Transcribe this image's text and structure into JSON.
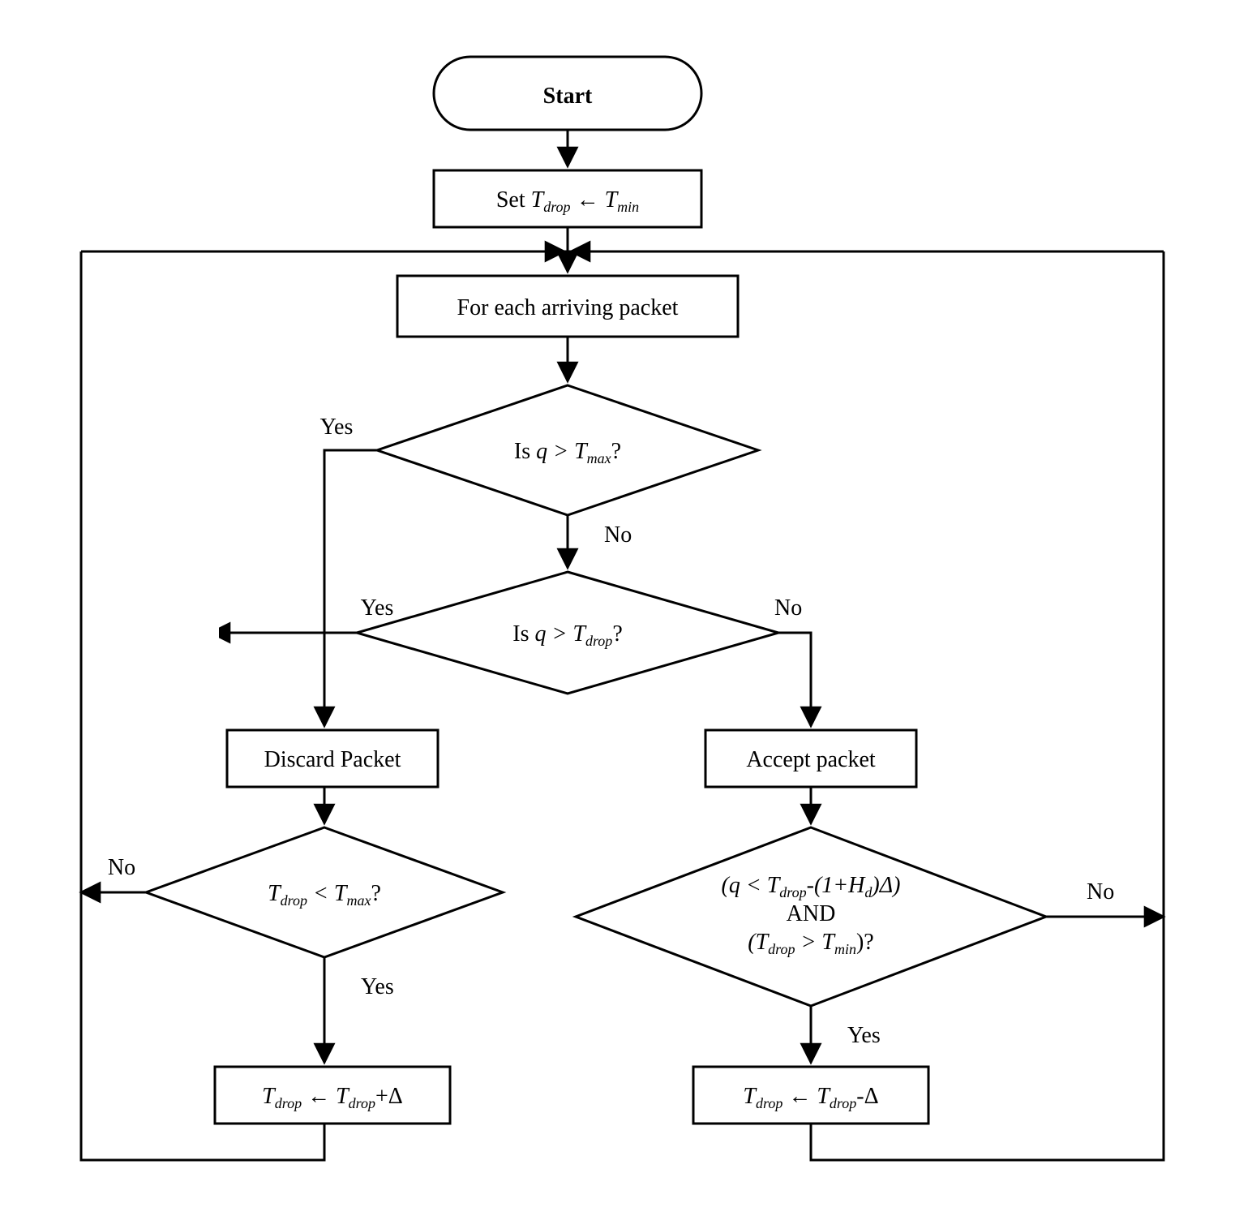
{
  "nodes": {
    "start": "Start",
    "init": {
      "prefix": "Set ",
      "Tdrop": "T",
      "drop": "drop",
      "arrow": " ← ",
      "Tmin": "T",
      "min": "min"
    },
    "loop": "For each arriving packet",
    "d1": {
      "prefix": "Is ",
      "q": "q",
      "gt": " > ",
      "T": "T",
      "max": "max",
      "suffix": "?"
    },
    "d2": {
      "prefix": "Is ",
      "q": "q",
      "gt": " > ",
      "T": "T",
      "drop": "drop",
      "suffix": "?"
    },
    "discard": "Discard Packet",
    "accept": "Accept packet",
    "d3": {
      "T": "T",
      "drop": "drop",
      "lt": " < ",
      "T2": "T",
      "max": "max",
      "suffix": "?"
    },
    "d4": {
      "line1a": "(q < T",
      "d4drop": "drop",
      "line1b": "-(1+H",
      "d4Hd": "d",
      "line1c": ")Δ)",
      "and": "AND",
      "line3a": "(T",
      "d4drop2": "drop",
      "line3b": " > T",
      "d4min": "min",
      "line3c": ")?"
    },
    "inc": {
      "T": "T",
      "drop": "drop",
      "arrow": " ← ",
      "T2": "T",
      "drop2": "drop",
      "plus": "+Δ"
    },
    "dec": {
      "T": "T",
      "drop": "drop",
      "arrow": " ← ",
      "T2": "T",
      "drop2": "drop",
      "minus": "-Δ"
    }
  },
  "edgeLabels": {
    "yes": "Yes",
    "no": "No"
  }
}
